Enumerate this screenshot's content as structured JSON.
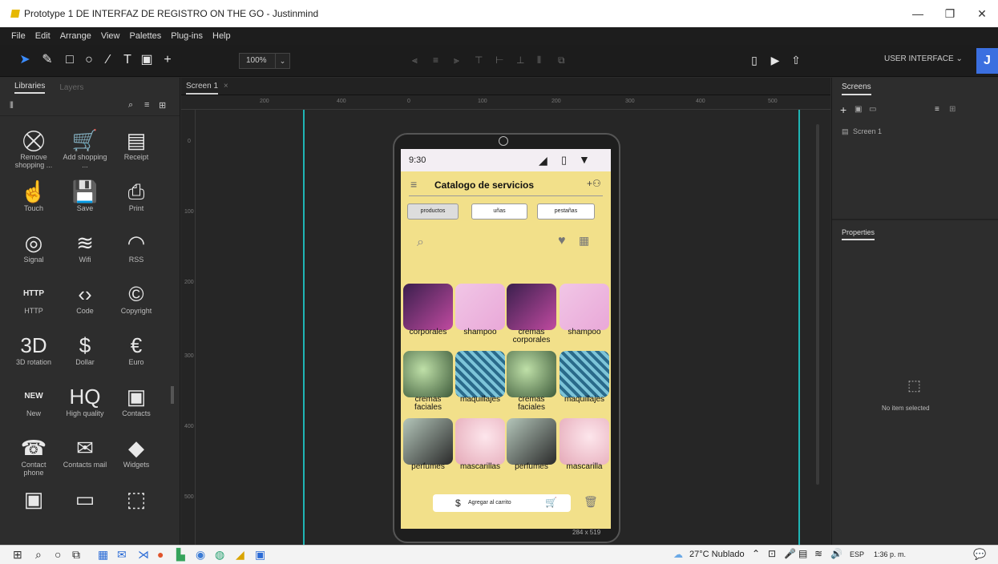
{
  "window": {
    "title": "Prototype 1 DE INTERFAZ DE REGISTRO ON THE GO - Justinmind",
    "minimize": "—",
    "restore": "❐",
    "close": "✕"
  },
  "menu": [
    "File",
    "Edit",
    "Arrange",
    "View",
    "Palettes",
    "Plug-ins",
    "Help"
  ],
  "toolbar": {
    "zoom_value": "100%",
    "user_interface_label": "USER INTERFACE ⌄",
    "avatar_initial": "J"
  },
  "left_panel": {
    "tabs": [
      "Libraries",
      "Layers"
    ],
    "widgets": [
      {
        "label": "Remove shopping ...",
        "icon": "remove-cart-icon",
        "glyph": "⛒"
      },
      {
        "label": "Add shopping ...",
        "icon": "add-cart-icon",
        "glyph": "🛒"
      },
      {
        "label": "Receipt",
        "icon": "receipt-icon",
        "glyph": "▤"
      },
      {
        "label": "Touch",
        "icon": "touch-icon",
        "glyph": "☝"
      },
      {
        "label": "Save",
        "icon": "save-icon",
        "glyph": "💾"
      },
      {
        "label": "Print",
        "icon": "print-icon",
        "glyph": "⎙"
      },
      {
        "label": "Signal",
        "icon": "signal-icon",
        "glyph": "◎"
      },
      {
        "label": "Wifi",
        "icon": "wifi-icon",
        "glyph": "≋"
      },
      {
        "label": "RSS",
        "icon": "rss-icon",
        "glyph": "◠"
      },
      {
        "label": "HTTP",
        "icon": "http-icon",
        "glyph": "HTTP"
      },
      {
        "label": "Code",
        "icon": "code-icon",
        "glyph": "‹›"
      },
      {
        "label": "Copyright",
        "icon": "copyright-icon",
        "glyph": "©"
      },
      {
        "label": "3D rotation",
        "icon": "rotation-3d-icon",
        "glyph": "3D"
      },
      {
        "label": "Dollar",
        "icon": "dollar-icon",
        "glyph": "$"
      },
      {
        "label": "Euro",
        "icon": "euro-icon",
        "glyph": "€"
      },
      {
        "label": "New",
        "icon": "new-icon",
        "glyph": "NEW"
      },
      {
        "label": "High quality",
        "icon": "hq-icon",
        "glyph": "HQ"
      },
      {
        "label": "Contacts",
        "icon": "contacts-icon",
        "glyph": "▣"
      },
      {
        "label": "Contact phone",
        "icon": "contact-phone-icon",
        "glyph": "☎"
      },
      {
        "label": "Contacts mail",
        "icon": "contacts-mail-icon",
        "glyph": "✉"
      },
      {
        "label": "Widgets",
        "icon": "widgets-icon",
        "glyph": "◆"
      },
      {
        "label": "",
        "icon": "image-frame-icon",
        "glyph": "▣"
      },
      {
        "label": "",
        "icon": "window-icon",
        "glyph": "▭"
      },
      {
        "label": "",
        "icon": "dashed-box-icon",
        "glyph": "⬚"
      }
    ]
  },
  "canvas": {
    "tab_label": "Screen 1",
    "tab_close": "×",
    "ruler_h": [
      "200",
      "400",
      "0",
      "100",
      "200",
      "300",
      "400",
      "500"
    ],
    "ruler_v": [
      "0",
      "100",
      "200",
      "300",
      "400",
      "500"
    ],
    "size_label": "284 x 519"
  },
  "phone": {
    "time": "9:30",
    "header_title": "Catalogo de servicios",
    "chips": [
      "productos",
      "uñas",
      "pestañas"
    ],
    "captions": [
      "corporales",
      "shampoo",
      "cremas corporales",
      "shampoo",
      "cremas faciales",
      "maquillajes",
      "cremas faciales",
      "maquillajes",
      "perfumes",
      "mascarillas",
      "perfumes",
      "mascarilla"
    ],
    "cart_label": "Agregar al carrito"
  },
  "right_panel": {
    "screens_tab": "Screens",
    "screen_item": "Screen 1",
    "properties_tab": "Properties",
    "empty_label": "No item selected"
  },
  "taskbar": {
    "weather": "27°C Nublado",
    "lang": "ESP",
    "time": "1:36 p. m."
  }
}
